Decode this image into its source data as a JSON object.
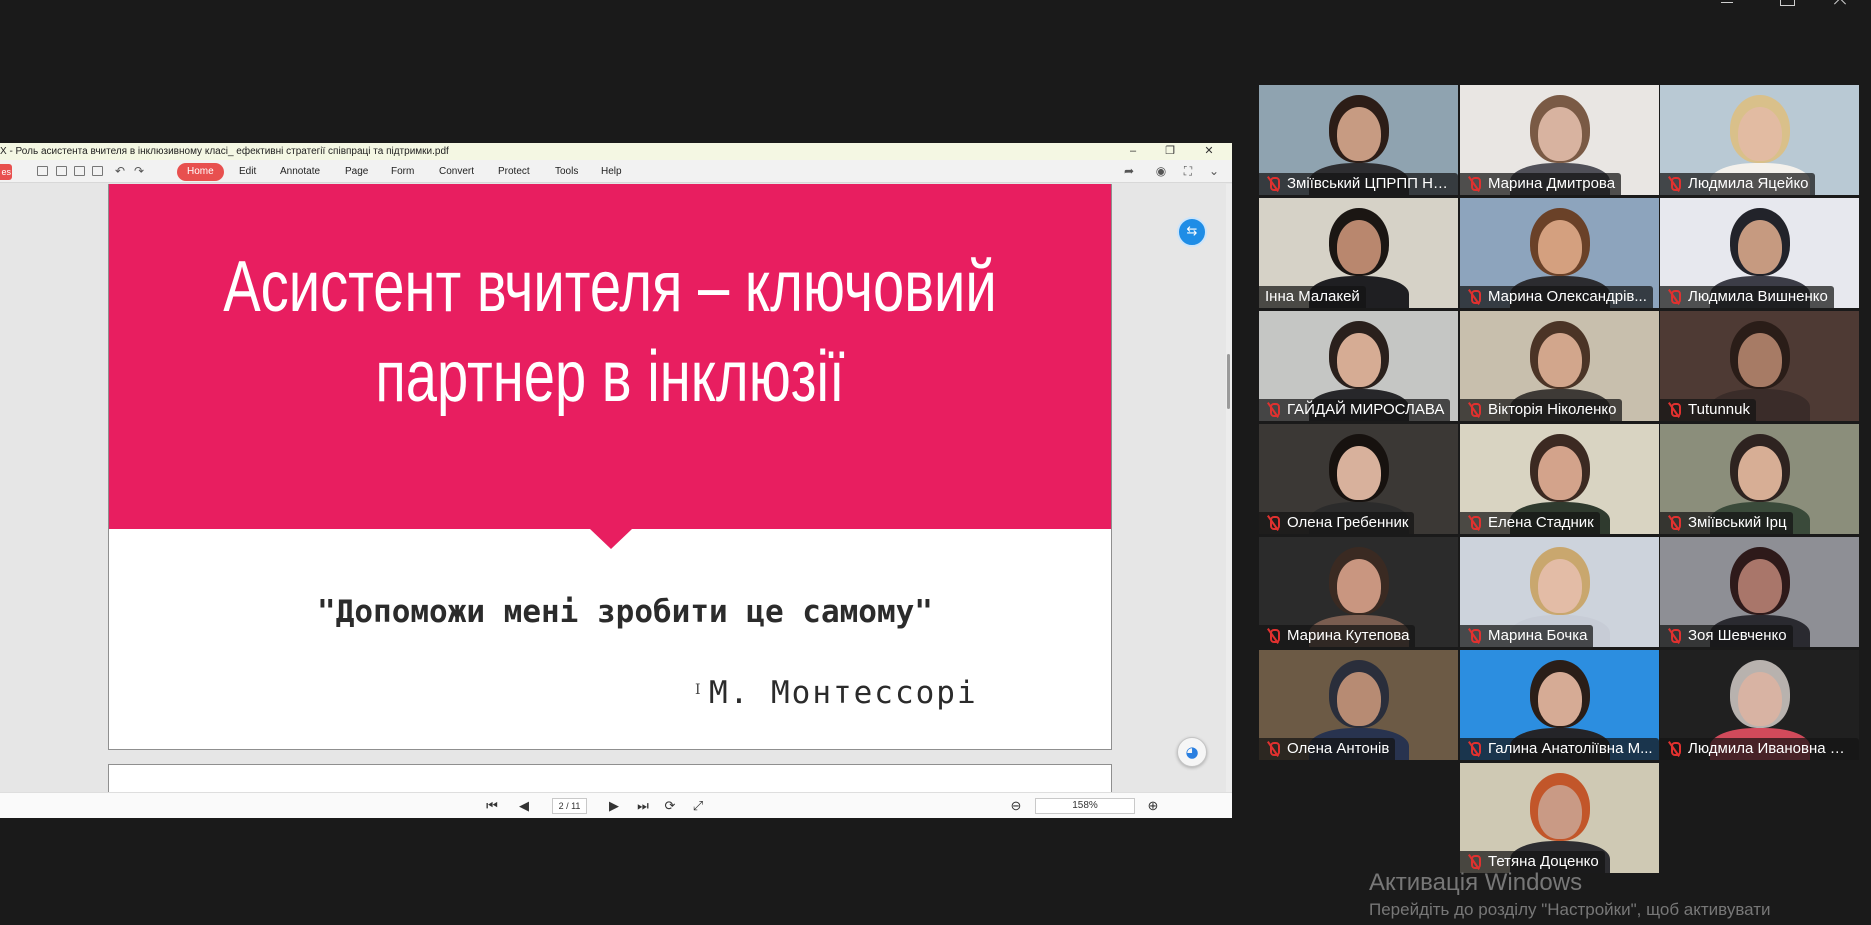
{
  "pdf_window": {
    "title": "X - Роль асистента вчителя в інклюзивному класі_ ефективні стратегії співпраці та підтримки.pdf",
    "left_tab_label": "es",
    "menu": [
      "Home",
      "Edit",
      "Annotate",
      "Page",
      "Form",
      "Convert",
      "Protect",
      "Tools",
      "Help"
    ],
    "active_menu": "Home"
  },
  "slide": {
    "title_line1": "Асистент вчителя – ключовий",
    "title_line2": "партнер в інклюзії",
    "quote": "\"Допоможи мені зробити це самому\"",
    "author": "М. Монтессорі",
    "banner_color": "#e81e60"
  },
  "statusbar": {
    "page_indicator": "2 / 11",
    "zoom": "158%"
  },
  "participants": [
    {
      "name": "Зміївський ЦПРПП На...",
      "muted": true,
      "speaking": false,
      "bg": "#8fa3b0",
      "skin": "#c79b82",
      "hair": "#2c1d17",
      "shirt": "#2d2d30"
    },
    {
      "name": "Марина Дмитрова",
      "muted": true,
      "speaking": false,
      "bg": "#e9e6e3",
      "skin": "#d8b3a0",
      "hair": "#7a5a45",
      "shirt": "#505058"
    },
    {
      "name": "Людмила Яцейко",
      "muted": true,
      "speaking": false,
      "bg": "#b9c9d4",
      "skin": "#e2bba2",
      "hair": "#d9c08a",
      "shirt": "#f4f1ec"
    },
    {
      "name": "Інна Малакей",
      "muted": false,
      "speaking": true,
      "bg": "#d6d2c7",
      "skin": "#b9876e",
      "hair": "#1b1613",
      "shirt": "#1f1f22"
    },
    {
      "name": "Марина Олександрів...",
      "muted": true,
      "speaking": false,
      "bg": "#8da4bd",
      "skin": "#d4a07f",
      "hair": "#6a4128",
      "shirt": "#2c2c30"
    },
    {
      "name": "Людмила Вишненко",
      "muted": true,
      "speaking": false,
      "bg": "#e7e8ee",
      "skin": "#c69a80",
      "hair": "#22232a",
      "shirt": "#3c3d47"
    },
    {
      "name": "ГАЙДАЙ  МИРОСЛАВА",
      "muted": true,
      "speaking": false,
      "bg": "#c5c6c4",
      "skin": "#d6ac94",
      "hair": "#2a201c",
      "shirt": "#27272a"
    },
    {
      "name": "Вікторія Ніколенко",
      "muted": true,
      "speaking": false,
      "bg": "#c8bfad",
      "skin": "#d2a68c",
      "hair": "#4b3426",
      "shirt": "#3e3a36"
    },
    {
      "name": "Tutunnuk",
      "muted": true,
      "speaking": false,
      "bg": "#4e3a34",
      "skin": "#a77b65",
      "hair": "#2a1d18",
      "shirt": "#3a2c29"
    },
    {
      "name": "Олена Гребенник",
      "muted": true,
      "speaking": false,
      "bg": "#3b3835",
      "skin": "#d8b19c",
      "hair": "#17120f",
      "shirt": "#2b2b2b"
    },
    {
      "name": "Елена Стадник",
      "muted": true,
      "speaking": false,
      "bg": "#d9d4c2",
      "skin": "#d3a38b",
      "hair": "#3c2a22",
      "shirt": "#2f3a2e"
    },
    {
      "name": "Зміївський Ірц",
      "muted": true,
      "speaking": false,
      "bg": "#8b8e7b",
      "skin": "#d7ae95",
      "hair": "#2e2320",
      "shirt": "#3a4a3a"
    },
    {
      "name": "Марина Кутепова",
      "muted": true,
      "speaking": false,
      "bg": "#2b2b2b",
      "skin": "#c99680",
      "hair": "#3a2a22",
      "shirt": "#7a5d50"
    },
    {
      "name": "Марина Бочка",
      "muted": true,
      "speaking": false,
      "bg": "#cdd3dc",
      "skin": "#e3bca6",
      "hair": "#c9a76e",
      "shirt": "#c7ccd6"
    },
    {
      "name": "Зоя Шевченко",
      "muted": true,
      "speaking": false,
      "bg": "#8e8f95",
      "skin": "#a9766a",
      "hair": "#2e1a1a",
      "shirt": "#2a2a30"
    },
    {
      "name": "Олена Антонів",
      "muted": true,
      "speaking": false,
      "bg": "#6c5a45",
      "skin": "#b78b73",
      "hair": "#2a2e3b",
      "shirt": "#28334f"
    },
    {
      "name": "Галина Анатоліївна М...",
      "muted": true,
      "speaking": false,
      "bg": "#2c8ee0",
      "skin": "#d6ab95",
      "hair": "#2a1e18",
      "shirt": "#242428"
    },
    {
      "name": "Людмила Ивановна С...",
      "muted": true,
      "speaking": false,
      "bg": "#202020",
      "skin": "#d8b3a3",
      "hair": "#b8b2ae",
      "shirt": "#d14a5b"
    },
    {
      "name": "Тетяна Доценко",
      "muted": true,
      "speaking": false,
      "bg": "#cfc9b4",
      "skin": "#c99a85",
      "hair": "#c2562a",
      "shirt": "#2d2d31"
    }
  ],
  "watermark": {
    "line1": "Активація Windows",
    "line2": "Перейдіть до розділу \"Настройки\", щоб активувати"
  }
}
